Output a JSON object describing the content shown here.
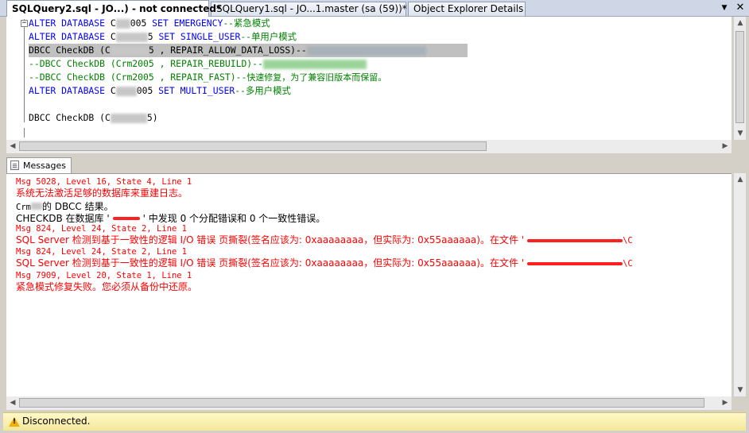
{
  "tabs": [
    {
      "label": "SQLQuery2.sql - JO...) - not connected*",
      "active": true
    },
    {
      "label": "SQLQuery1.sql - JO...1.master (sa (59))*",
      "active": false
    },
    {
      "label": "Object Explorer Details",
      "active": false
    }
  ],
  "tab_controls": {
    "dropdown": "▼",
    "close": "✕"
  },
  "editor": {
    "lines": [
      {
        "kw1": "ALTER DATABASE",
        "obj": "C",
        "obj2": "005",
        "kw2": "SET EMERGENCY",
        "cmt": "--紧急模式"
      },
      {
        "kw1": "ALTER DATABASE",
        "obj": "C",
        "obj2": "5",
        "kw2": "SET SINGLE_USER",
        "cmt": "--单用户模式"
      },
      {
        "a": "DBCC CheckDB (C",
        "b": "5 , REPAIR_ALLOW_DATA_LOSS)",
        "cmt": "--"
      },
      {
        "cmt": "--DBCC CheckDB (Crm2005 , REPAIR_REBUILD)--"
      },
      {
        "cmt": "--DBCC CheckDB (Crm2005 , REPAIR_FAST)--",
        "cmt_cn": "快速修复，为了兼容旧版本而保留。"
      },
      {
        "kw1": "ALTER DATABASE",
        "obj": "C",
        "obj2": "005",
        "kw2": "SET MULTI_USER",
        "cmt": "--多用户模式"
      },
      {
        "a": "DBCC CheckDB (C",
        "b": "5)"
      }
    ]
  },
  "results": {
    "tab_label": "Messages",
    "messages": [
      {
        "text": "Msg 5028, Level 16, State 4, Line 1",
        "type": "header"
      },
      {
        "text": "系统无法激活足够的数据库来重建日志。",
        "type": "error"
      },
      {
        "pre": "Crm",
        "mid": "的 DBCC 结果。",
        "type": "info"
      },
      {
        "pre": "CHECKDB 在数据库 '",
        "post": "' 中发现 0 个分配错误和 0 个一致性错误。",
        "type": "info"
      },
      {
        "text": "Msg 824, Level 24, State 2, Line 1",
        "type": "header"
      },
      {
        "text": "SQL Server 检测到基于一致性的逻辑 I/O 错误 页撕裂(签名应该为: 0xaaaaaaaa，但实际为: 0x55aaaaaa)。在文件 '",
        "tail": "\\C",
        "type": "error"
      },
      {
        "text": "Msg 824, Level 24, State 2, Line 1",
        "type": "header"
      },
      {
        "text": "SQL Server 检测到基于一致性的逻辑 I/O 错误 页撕裂(签名应该为: 0xaaaaaaaa，但实际为: 0x55aaaaaa)。在文件 '",
        "tail": "\\C",
        "type": "error"
      },
      {
        "text": "Msg 7909, Level 20, State 1, Line 1",
        "type": "header"
      },
      {
        "text": "紧急模式修复失败。您必须从备份中还原。",
        "type": "error"
      }
    ]
  },
  "status": {
    "text": "Disconnected."
  },
  "colors": {
    "keyword": "#0000ff",
    "comment": "#008000",
    "error": "#ff0000",
    "status_bg": "#fff2b3"
  }
}
